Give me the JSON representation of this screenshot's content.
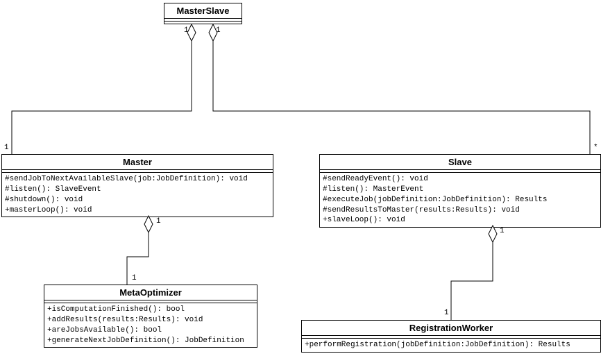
{
  "classes": {
    "masterslave": {
      "name": "MasterSlave",
      "operations": []
    },
    "master": {
      "name": "Master",
      "operations": [
        "#sendJobToNextAvailableSlave(job:JobDefinition): void",
        "#listen(): SlaveEvent",
        "#shutdown(): void",
        "+masterLoop(): void"
      ]
    },
    "slave": {
      "name": "Slave",
      "operations": [
        "#sendReadyEvent(): void",
        "#listen(): MasterEvent",
        "#executeJob(jobDefinition:JobDefinition): Results",
        "#sendResultsToMaster(results:Results): void",
        "+slaveLoop(): void"
      ]
    },
    "metaoptimizer": {
      "name": "MetaOptimizer",
      "operations": [
        "+isComputationFinished(): bool",
        "+addResults(results:Results): void",
        "+areJobsAvailable(): bool",
        "+generateNextJobDefinition(): JobDefinition"
      ]
    },
    "registrationworker": {
      "name": "RegistrationWorker",
      "operations": [
        "+performRegistration(jobDefinition:JobDefinition): Results"
      ]
    }
  },
  "mult": {
    "ms_left": "1",
    "ms_right": "1",
    "master_top": "1",
    "slave_top": "*",
    "master_bottom": "1",
    "metaopt_top": "1",
    "slave_bottom": "1",
    "regworker_top": "1"
  },
  "chart_data": {
    "type": "diagram",
    "kind": "uml-class",
    "classes": [
      {
        "name": "MasterSlave",
        "operations": [],
        "attributes": []
      },
      {
        "name": "Master",
        "attributes": [],
        "operations": [
          "#sendJobToNextAvailableSlave(job:JobDefinition): void",
          "#listen(): SlaveEvent",
          "#shutdown(): void",
          "+masterLoop(): void"
        ]
      },
      {
        "name": "Slave",
        "attributes": [],
        "operations": [
          "#sendReadyEvent(): void",
          "#listen(): MasterEvent",
          "#executeJob(jobDefinition:JobDefinition): Results",
          "#sendResultsToMaster(results:Results): void",
          "+slaveLoop(): void"
        ]
      },
      {
        "name": "MetaOptimizer",
        "attributes": [],
        "operations": [
          "+isComputationFinished(): bool",
          "+addResults(results:Results): void",
          "+areJobsAvailable(): bool",
          "+generateNextJobDefinition(): JobDefinition"
        ]
      },
      {
        "name": "RegistrationWorker",
        "attributes": [],
        "operations": [
          "+performRegistration(jobDefinition:JobDefinition): Results"
        ]
      }
    ],
    "relationships": [
      {
        "type": "aggregation",
        "whole": "MasterSlave",
        "part": "Master",
        "wholeMult": "1",
        "partMult": "1"
      },
      {
        "type": "aggregation",
        "whole": "MasterSlave",
        "part": "Slave",
        "wholeMult": "1",
        "partMult": "*"
      },
      {
        "type": "aggregation",
        "whole": "Master",
        "part": "MetaOptimizer",
        "wholeMult": "1",
        "partMult": "1"
      },
      {
        "type": "aggregation",
        "whole": "Slave",
        "part": "RegistrationWorker",
        "wholeMult": "1",
        "partMult": "1"
      }
    ]
  }
}
